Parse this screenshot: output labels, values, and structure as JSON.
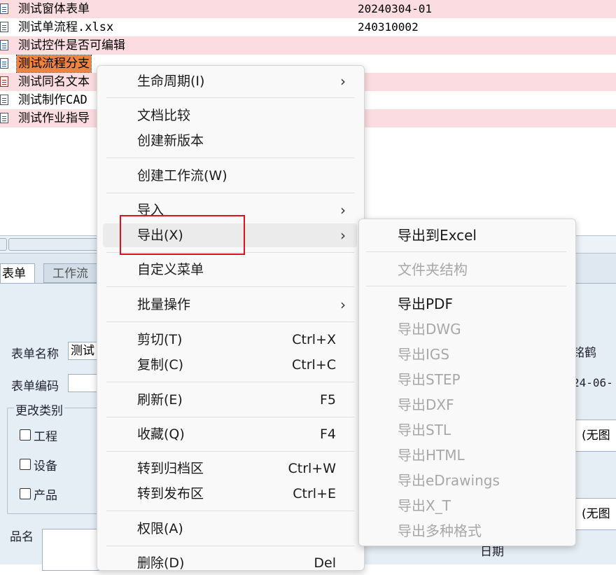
{
  "file_list": {
    "rows": [
      {
        "name": "测试窗体表单",
        "code": "20240304-01"
      },
      {
        "name": "测试单流程.xlsx",
        "code": "240310002"
      },
      {
        "name": "测试控件是否可编辑",
        "code": ""
      },
      {
        "name": "测试流程分支",
        "code": ""
      },
      {
        "name": "测试同名文本",
        "code": ""
      },
      {
        "name": "测试制作CAD"
      },
      {
        "name": "测试作业指导"
      }
    ]
  },
  "form": {
    "tabs": [
      "表单",
      "工作流"
    ],
    "labels": {
      "form_name": "表单名称",
      "form_code": "表单编码",
      "change_type": "更改类别",
      "product_name": "品名",
      "date": "日期"
    },
    "values": {
      "form_name": "测试",
      "right_name": "铭鹤",
      "right_date": "24-06-",
      "no_image_1": "(无图",
      "no_image_2": "(无图"
    },
    "checkboxes": [
      "工程",
      "设备",
      "产品"
    ]
  },
  "context_menu": {
    "items": [
      {
        "label": "生命周期(I)",
        "has_submenu": true
      },
      {
        "label": "文档比较"
      },
      {
        "label": "创建新版本"
      },
      {
        "label": "创建工作流(W)"
      },
      {
        "label": "导入",
        "has_submenu": true
      },
      {
        "label": "导出(X)",
        "has_submenu": true,
        "highlighted": true
      },
      {
        "label": "自定义菜单"
      },
      {
        "label": "批量操作",
        "has_submenu": true
      },
      {
        "label": "剪切(T)",
        "shortcut": "Ctrl+X"
      },
      {
        "label": "复制(C)",
        "shortcut": "Ctrl+C"
      },
      {
        "label": "刷新(E)",
        "shortcut": "F5"
      },
      {
        "label": "收藏(Q)",
        "shortcut": "F4"
      },
      {
        "label": "转到归档区",
        "shortcut": "Ctrl+W"
      },
      {
        "label": "转到发布区",
        "shortcut": "Ctrl+E"
      },
      {
        "label": "权限(A)"
      },
      {
        "label": "删除(D)",
        "shortcut": "Del"
      }
    ],
    "arrow": "›"
  },
  "export_submenu": {
    "items": [
      {
        "label": "导出到Excel",
        "enabled": true
      },
      {
        "label": "文件夹结构",
        "enabled": false
      },
      {
        "label": "导出PDF",
        "enabled": true
      },
      {
        "label": "导出DWG",
        "enabled": false
      },
      {
        "label": "导出IGS",
        "enabled": false
      },
      {
        "label": "导出STEP",
        "enabled": false
      },
      {
        "label": "导出DXF",
        "enabled": false
      },
      {
        "label": "导出STL",
        "enabled": false
      },
      {
        "label": "导出HTML",
        "enabled": false
      },
      {
        "label": "导出eDrawings",
        "enabled": false
      },
      {
        "label": "导出X_T",
        "enabled": false
      },
      {
        "label": "导出多种格式",
        "enabled": false
      }
    ]
  },
  "colors": {
    "row_pink": "#fbdce0",
    "selected_orange": "#f0843f",
    "highlight_red": "#e0101c",
    "disabled_gray": "#a8a8a8"
  }
}
